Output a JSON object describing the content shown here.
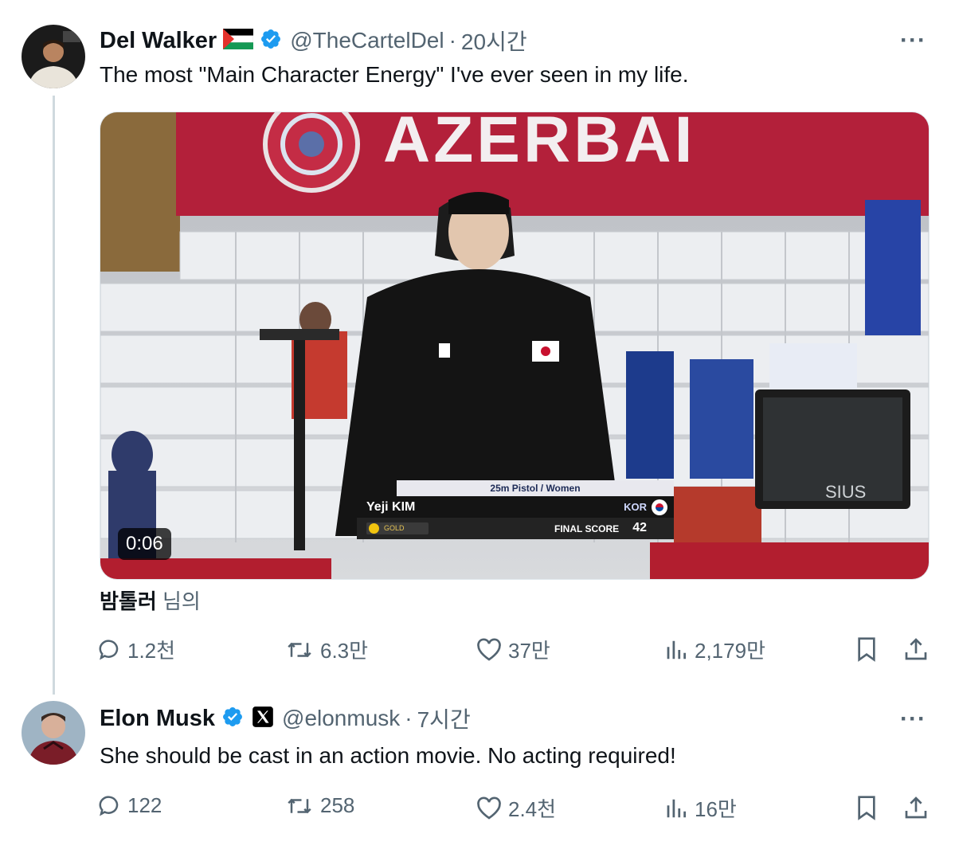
{
  "tweets": [
    {
      "author": "Del Walker",
      "handle": "@TheCartelDel",
      "time": "20시간",
      "text": "The most \"Main Character Energy\" I've ever seen in my life.",
      "media": {
        "duration": "0:06",
        "banner_text": "AZERBAI",
        "monitor_brand": "SIUS",
        "scoreboard": {
          "event": "25m Pistol / Women",
          "athlete": "Yeji KIM",
          "country": "KOR",
          "medal": "GOLD",
          "final_label": "FINAL SCORE",
          "score": "42"
        }
      },
      "attribution": {
        "user": "밤톨러",
        "suffix": " 님의"
      },
      "stats": {
        "replies": "1.2천",
        "reposts": "6.3만",
        "likes": "37만",
        "views": "2,179만"
      }
    },
    {
      "author": "Elon Musk",
      "handle": "@elonmusk",
      "time": "7시간",
      "text": "She should be cast in an action movie. No  acting required!",
      "stats": {
        "replies": "122",
        "reposts": "258",
        "likes": "2.4천",
        "views": "16만"
      }
    }
  ],
  "colors": {
    "verified_blue": "#1d9bf0",
    "text_primary": "#0f1419",
    "text_secondary": "#536471",
    "thread_line": "#cfd9de"
  },
  "icons": [
    "reply-icon",
    "repost-icon",
    "like-icon",
    "views-icon",
    "bookmark-icon",
    "share-icon",
    "more-icon",
    "verified-icon",
    "flag-icon",
    "x-affiliate-icon"
  ]
}
